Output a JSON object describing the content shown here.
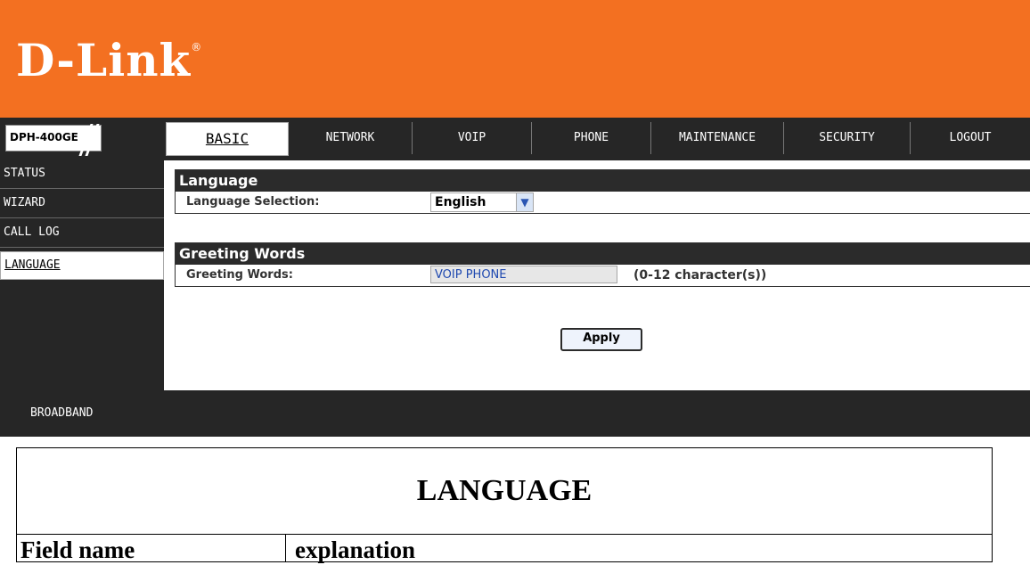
{
  "brand": {
    "logo_text": "D-Link",
    "registered": "®",
    "color": "#f37021"
  },
  "model": "DPH-400GE",
  "tabs": [
    {
      "label": "BASIC"
    },
    {
      "label": "NETWORK"
    },
    {
      "label": "VOIP"
    },
    {
      "label": "PHONE"
    },
    {
      "label": "MAINTENANCE"
    },
    {
      "label": "SECURITY"
    },
    {
      "label": "LOGOUT"
    }
  ],
  "sidebar": {
    "items": [
      {
        "label": "STATUS"
      },
      {
        "label": "WIZARD"
      },
      {
        "label": "CALL LOG"
      },
      {
        "label": "LANGUAGE"
      }
    ]
  },
  "language_section": {
    "title": "Language",
    "label": "Language Selection:",
    "value": "English"
  },
  "greeting_section": {
    "title": "Greeting Words",
    "label": "Greeting Words:",
    "value": "VOIP PHONE",
    "hint": "(0-12 character(s))"
  },
  "apply_label": "Apply",
  "footer": {
    "label": "BROADBAND"
  },
  "doc": {
    "title": "LANGUAGE",
    "col1": "Field name",
    "col2": "explanation"
  }
}
